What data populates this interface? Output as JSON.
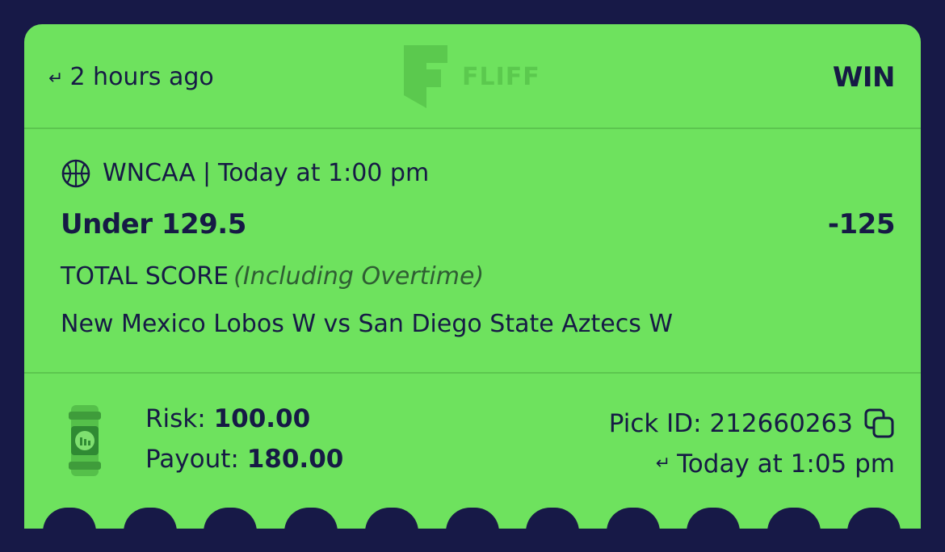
{
  "header": {
    "time_ago": "2 hours ago",
    "brand": "FLIFF",
    "result": "WIN"
  },
  "pick": {
    "league": "WNCAA",
    "separator": "|",
    "start_time": "Today at 1:00 pm",
    "selection": "Under 129.5",
    "odds": "-125",
    "market": "TOTAL SCORE",
    "market_note": "(Including Overtime)",
    "matchup": "New Mexico Lobos W vs San Diego State Aztecs W"
  },
  "footer": {
    "risk_label": "Risk:",
    "risk_value": "100.00",
    "payout_label": "Payout:",
    "payout_value": "180.00",
    "pick_id_label": "Pick ID:",
    "pick_id": "212660263",
    "settled_time": "Today at 1:05 pm"
  },
  "icons": {
    "sport": "basketball-icon",
    "copy": "copy-icon",
    "ticket": "ticket-icon",
    "arrow": "return-arrow-icon"
  },
  "colors": {
    "background": "#171947",
    "card": "#6ee25e",
    "text": "#161a45",
    "brand_watermark": "#5bc94e"
  }
}
